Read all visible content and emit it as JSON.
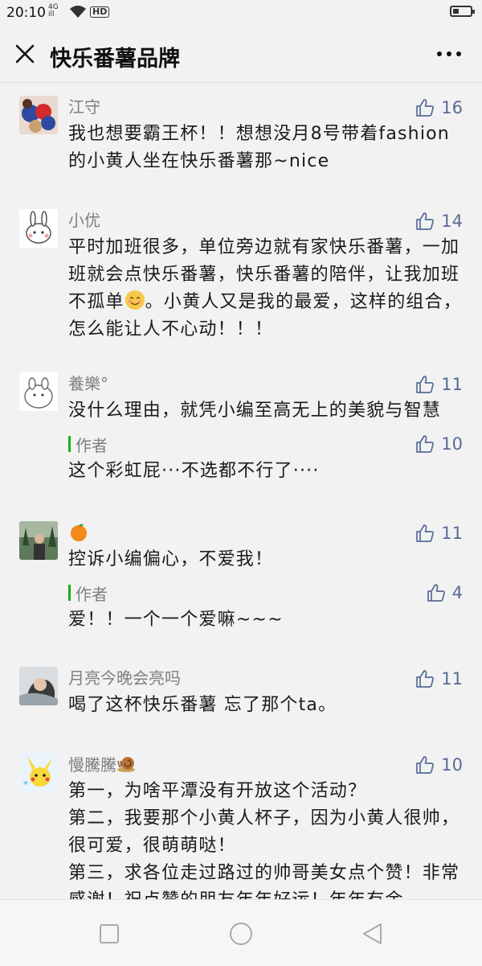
{
  "status_bar": {
    "time": "20:10",
    "network_top": "4G",
    "network_bottom": "ill",
    "hd": "HD",
    "battery_level": 0.35
  },
  "header": {
    "title": "快乐番薯品牌",
    "close_icon": "close-icon",
    "more_icon": "more-icon"
  },
  "comments": [
    {
      "user": "江守",
      "likes": "16",
      "text": "我也想要霸王杯！！想想没月8号带着fashion的小黄人坐在快乐番薯那~nice"
    },
    {
      "user": "小优",
      "likes": "14",
      "text_a": "平时加班很多，单位旁边就有家快乐番薯，一加班就会点快乐番薯，快乐番薯的陪伴，让我加班不孤单",
      "text_b": "。小黄人又是我的最爱，这样的组合，怎么能让人不心动！！！"
    },
    {
      "user": "養樂°",
      "likes": "11",
      "text": "没什么理由，就凭小编至高无上的美貌与智慧",
      "reply": {
        "label": "作者",
        "likes": "10",
        "text": "这个彩虹屁···不选都不行了····"
      }
    },
    {
      "user": "",
      "likes": "11",
      "text": "控诉小编偏心，不爱我！",
      "reply": {
        "label": "作者",
        "likes": "4",
        "text": "爱！！一个一个爱嘛~~~"
      }
    },
    {
      "user": "月亮今晚会亮吗",
      "likes": "11",
      "text": "喝了这杯快乐番薯 忘了那个ta。"
    },
    {
      "user": "慢騰騰",
      "likes": "10",
      "lines": [
        "第一，为啥平潭没有开放这个活动？",
        "第二，我要那个小黄人杯子，因为小黄人很帅，很可爱，很萌萌哒！",
        "第三，求各位走过路过的帅哥美女点个赞！非常感谢！祝点赞的朋友年年好运！年年有余"
      ]
    }
  ],
  "nav": {
    "recent_icon": "square-icon",
    "home_icon": "circle-icon",
    "back_icon": "triangle-back-icon"
  },
  "colors": {
    "like": "#576b95",
    "author_bar": "#1aad19",
    "background": "#f2f2f2"
  }
}
